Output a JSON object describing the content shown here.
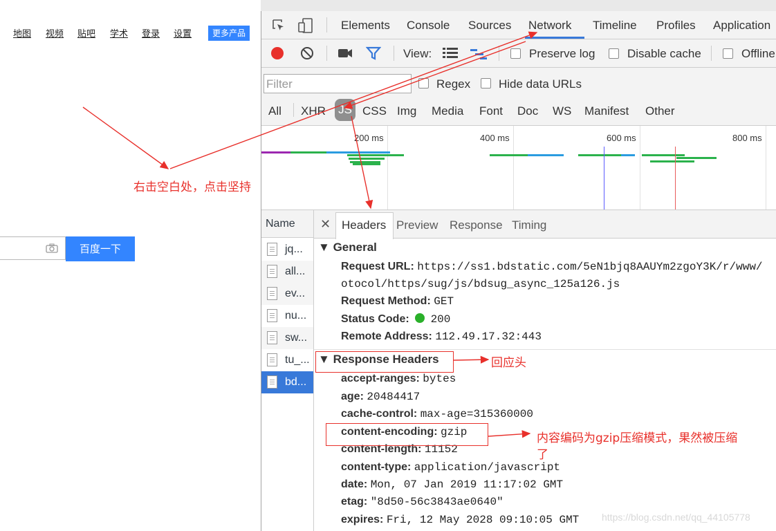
{
  "baidu": {
    "nav": [
      "地图",
      "视频",
      "贴吧",
      "学术",
      "登录",
      "设置"
    ],
    "more_button": "更多产品",
    "search_button": "百度一下"
  },
  "devtools": {
    "tabs": [
      "Elements",
      "Console",
      "Sources",
      "Network",
      "Timeline",
      "Profiles",
      "Application"
    ],
    "active_tab": "Network",
    "toolbar": {
      "view_label": "View:",
      "preserve_log": "Preserve log",
      "disable_cache": "Disable cache",
      "offline": "Offline"
    },
    "filter": {
      "placeholder": "Filter",
      "regex": "Regex",
      "hide_data_urls": "Hide data URLs"
    },
    "types": [
      "All",
      "XHR",
      "JS",
      "CSS",
      "Img",
      "Media",
      "Font",
      "Doc",
      "WS",
      "Manifest",
      "Other"
    ],
    "active_type": "JS",
    "timeline_ticks": [
      "200 ms",
      "400 ms",
      "600 ms",
      "800 ms"
    ],
    "name_header": "Name",
    "files": [
      "jq...",
      "all...",
      "ev...",
      "nu...",
      "sw...",
      "tu_...",
      "bd..."
    ],
    "selected_file": "bd...",
    "detail_tabs": [
      "Headers",
      "Preview",
      "Response",
      "Timing"
    ],
    "active_detail_tab": "Headers",
    "general": {
      "title": "General",
      "rows": [
        {
          "key": "Request URL:",
          "value": "https://ss1.bdstatic.com/5eN1bjq8AAUYm2zgoY3K/r/www/"
        },
        {
          "key": "",
          "value": "otocol/https/sug/js/bdsug_async_125a126.js"
        },
        {
          "key": "Request Method:",
          "value": "GET"
        },
        {
          "key": "Status Code:",
          "value": "200"
        },
        {
          "key": "Remote Address:",
          "value": "112.49.17.32:443"
        }
      ]
    },
    "response_headers": {
      "title": "Response Headers",
      "rows": [
        {
          "key": "accept-ranges:",
          "value": "bytes"
        },
        {
          "key": "age:",
          "value": "20484417"
        },
        {
          "key": "cache-control:",
          "value": "max-age=315360000"
        },
        {
          "key": "content-encoding:",
          "value": "gzip"
        },
        {
          "key": "content-length:",
          "value": "11152"
        },
        {
          "key": "content-type:",
          "value": "application/javascript"
        },
        {
          "key": "date:",
          "value": "Mon, 07 Jan 2019 11:17:02 GMT"
        },
        {
          "key": "etag:",
          "value": "\"8d50-56c3843ae0640\""
        },
        {
          "key": "expires:",
          "value": "Fri, 12 May 2028 09:10:05 GMT"
        }
      ]
    }
  },
  "annotations": {
    "right_click": "右击空白处，点击坚持",
    "response_header": "回应头",
    "encoding_line1": "内容编码为gzip压缩模式，果然被压缩",
    "encoding_line2": "了"
  },
  "watermark": "https://blog.csdn.net/qq_44105778",
  "colors": {
    "accent": "#3879d9",
    "annotation": "#e8302b",
    "baidu_blue": "#3385ff",
    "record": "#e8302b",
    "status_ok": "#2ab02a"
  }
}
